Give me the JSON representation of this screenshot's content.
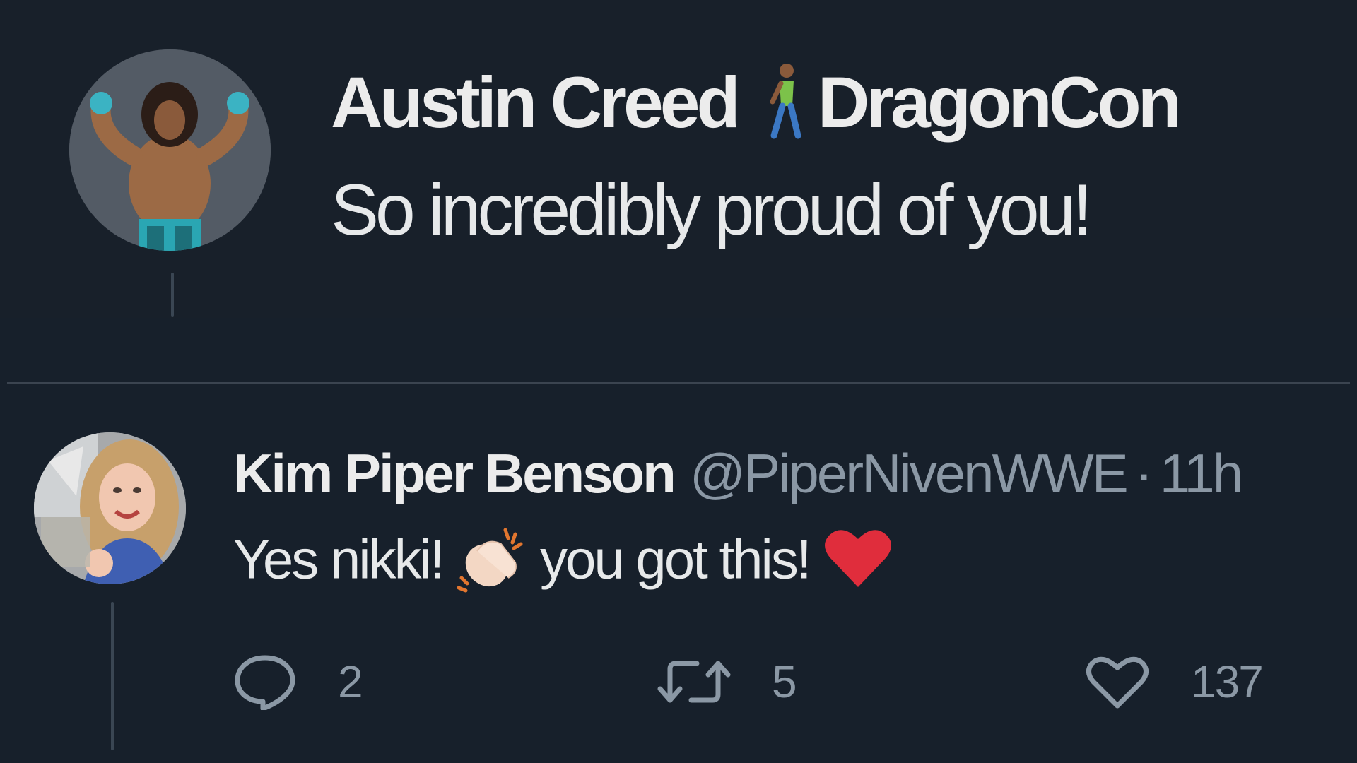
{
  "parent_tweet": {
    "display_name": "Austin Creed",
    "name_suffix": "DragonCon",
    "text": "So incredibly proud of you!",
    "name_emoji": "person-walking-icon"
  },
  "reply_tweet": {
    "display_name": "Kim Piper Benson",
    "handle": "@PiperNivenWWE",
    "separator": "·",
    "time": "11h",
    "text_part1": "Yes nikki!",
    "text_part2": "you got this!",
    "emojis": [
      "clapping-hands-icon",
      "red-heart-icon"
    ],
    "actions": {
      "reply_count": "2",
      "retweet_count": "5",
      "like_count": "137"
    }
  },
  "colors": {
    "background": "#17202b",
    "text": "#e7e9ea",
    "secondary_text": "#8b98a5",
    "heart": "#e0245e"
  }
}
